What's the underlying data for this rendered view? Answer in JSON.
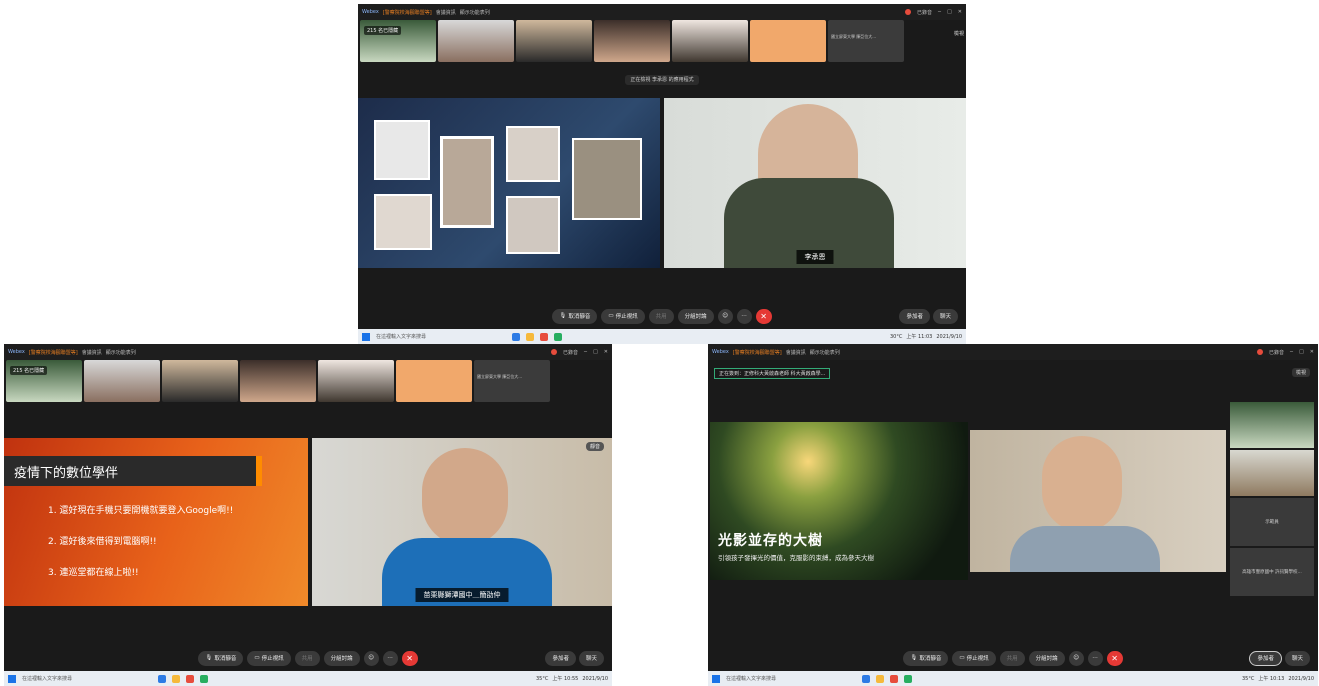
{
  "s1": {
    "app": "Webex",
    "meeting_name": "[警察院校海鷗聯盟等]",
    "tab_info": "會議資訊",
    "tab_more": "顯示功能表列",
    "rec_label": "已錄音",
    "participants_badge": "215 名已隱藏",
    "thumb_label": "國立屏東大學 陳亞位大...",
    "side_btn": "檢視",
    "sharing_text": "正在檢視 李承恩 的應用程式",
    "speaker_name": "李承恩",
    "controls": {
      "mute": "取消靜音",
      "video": "停止視訊",
      "share": "共用",
      "breakout": "分組討論",
      "participants": "參加者",
      "chat": "聊天"
    },
    "taskbar": {
      "search": "在這裡輸入文字來搜尋",
      "weather": "30°C",
      "time": "上午 11:03",
      "date": "2021/9/10"
    }
  },
  "s2": {
    "app": "Webex",
    "meeting_name": "[警察院校海鷗聯盟等]",
    "tab_info": "會議資訊",
    "tab_more": "顯示功能表列",
    "rec_label": "已錄音",
    "participants_badge": "215 名已隱藏",
    "thumb_label": "國立屏東大學 陳亞位大...",
    "slide_title": "疫情下的數位學伴",
    "slide_items": [
      "1. 還好現在手機只要開機就要登入Google啊!!",
      "2. 還好後來借得到電腦啊!!",
      "3. 連巡堂都在線上啦!!"
    ],
    "speaker_name": "苗栗縣獅潭國中＿簡劭仲",
    "side_btn": "靜音",
    "controls": {
      "mute": "取消靜音",
      "video": "停止視訊",
      "share": "共用",
      "breakout": "分組討論",
      "participants": "參加者",
      "chat": "聊天"
    },
    "taskbar": {
      "search": "在這裡輸入文字來搜尋",
      "weather": "35°C",
      "time": "上午 10:55",
      "date": "2021/9/10"
    }
  },
  "s3": {
    "app": "Webex",
    "meeting_name": "[警察院校海鷗聯盟等]",
    "tab_info": "會議資訊",
    "tab_more": "顯示功能表列",
    "rec_label": "已錄音",
    "sharing_text": "正在簽到：正修科大黃啟森老師 科大黃啟森學...",
    "side_btn": "檢視",
    "slide_title": "光影並存的大樹",
    "slide_sub": "引領孩子發揮光的價值，克服影的束縛，成為參天大樹",
    "side_tile_1": "示範員",
    "side_tile_2": "高雄市豐原國中 許訊賢學校...",
    "controls": {
      "mute": "取消靜音",
      "video": "停止視訊",
      "share": "共用",
      "breakout": "分組討論",
      "participants": "參加者",
      "chat": "聊天"
    },
    "taskbar": {
      "search": "在這裡輸入文字來搜尋",
      "weather": "35°C",
      "time": "上午 10:13",
      "date": "2021/9/10"
    }
  }
}
